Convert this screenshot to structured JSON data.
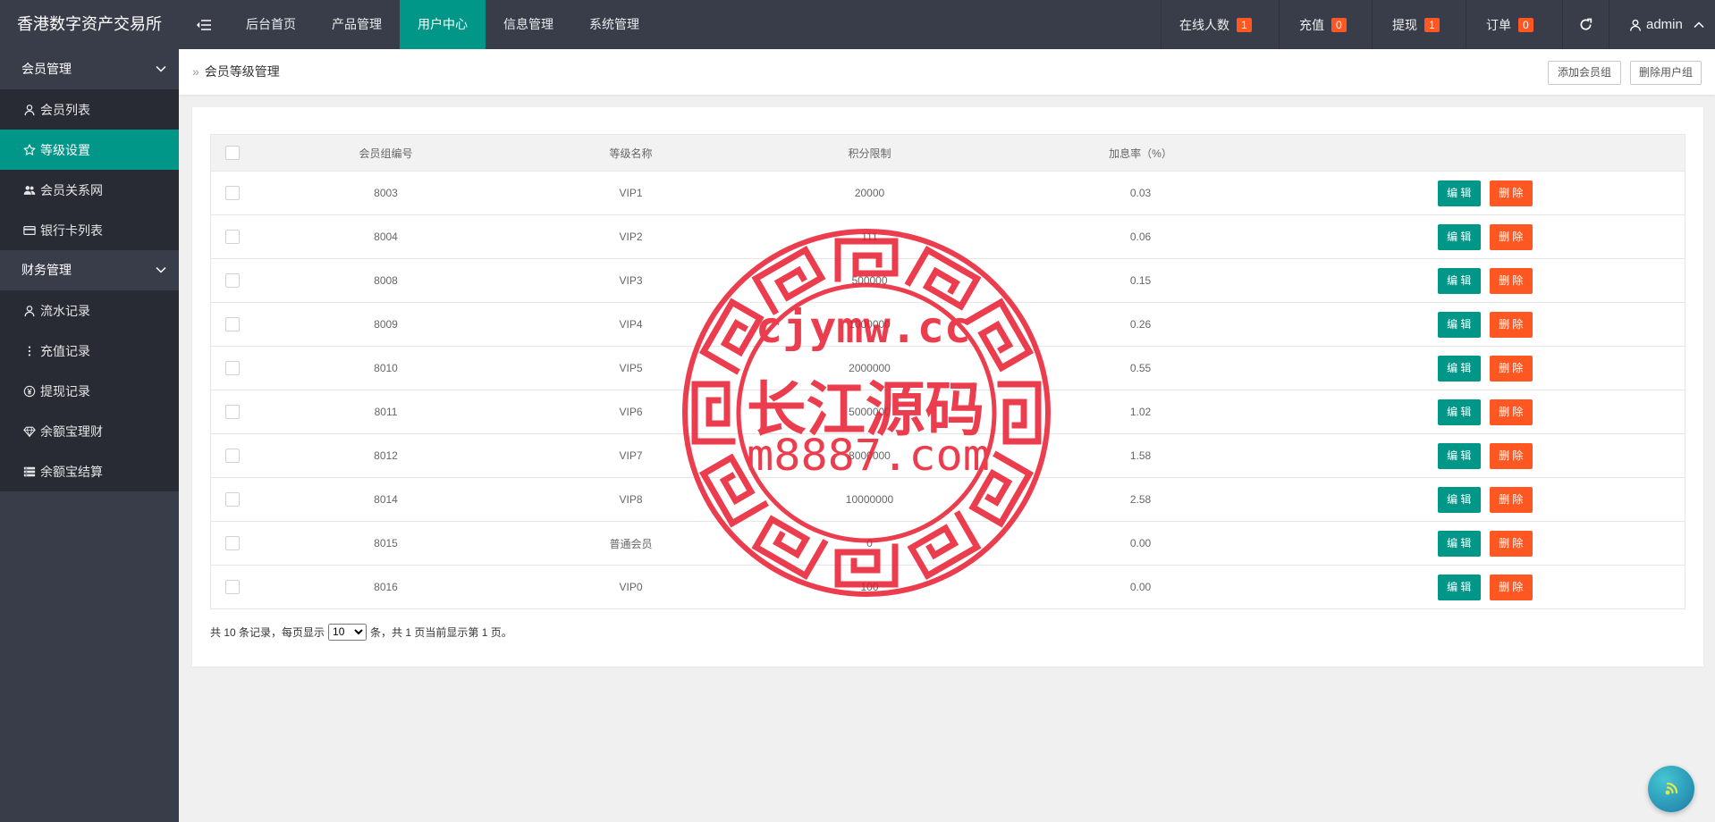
{
  "app": {
    "title": "香港数字资产交易所"
  },
  "colors": {
    "header_bg": "#393D49",
    "sidebar_sub_bg": "#282B33",
    "accent": "#009688",
    "danger": "#FF5722",
    "badge": "#FF5722",
    "watermark": "#E8192C"
  },
  "header": {
    "toggle_icon": "menu-shrink-icon",
    "nav": [
      {
        "label": "后台首页"
      },
      {
        "label": "产品管理"
      },
      {
        "label": "用户中心",
        "active": true
      },
      {
        "label": "信息管理"
      },
      {
        "label": "系统管理"
      }
    ],
    "stats": [
      {
        "label": "在线人数",
        "count": "1"
      },
      {
        "label": "充值",
        "count": "0"
      },
      {
        "label": "提现",
        "count": "1"
      },
      {
        "label": "订单",
        "count": "0"
      }
    ],
    "refresh_icon": "refresh-icon",
    "user": {
      "name": "admin",
      "icon": "user-icon",
      "caret_icon": "chevron-up-icon"
    }
  },
  "sidebar": {
    "groups": [
      {
        "label": "会员管理",
        "expanded": true,
        "items": [
          {
            "label": "会员列表",
            "icon": "user-icon"
          },
          {
            "label": "等级设置",
            "icon": "star-icon",
            "active": true
          },
          {
            "label": "会员关系网",
            "icon": "users-icon"
          },
          {
            "label": "银行卡列表",
            "icon": "credit-card-icon"
          }
        ]
      },
      {
        "label": "财务管理",
        "expanded": true,
        "items": [
          {
            "label": "流水记录",
            "icon": "user-icon"
          },
          {
            "label": "充值记录",
            "icon": "more-vertical-icon"
          },
          {
            "label": "提现记录",
            "icon": "yen-circle-icon"
          },
          {
            "label": "余额宝理财",
            "icon": "diamond-icon"
          },
          {
            "label": "余额宝结算",
            "icon": "server-icon"
          }
        ]
      }
    ]
  },
  "breadcrumb": {
    "separator": "»",
    "current": "会员等级管理"
  },
  "toolbar": {
    "add_label": "添加会员组",
    "delete_label": "删除用户组"
  },
  "table": {
    "columns": [
      "会员组编号",
      "等级名称",
      "积分限制",
      "加息率（%）"
    ],
    "rows": [
      {
        "id": "8003",
        "level": "VIP1",
        "points": "20000",
        "rate": "0.03"
      },
      {
        "id": "8004",
        "level": "VIP2",
        "points": "111",
        "rate": "0.06"
      },
      {
        "id": "8008",
        "level": "VIP3",
        "points": "500000",
        "rate": "0.15"
      },
      {
        "id": "8009",
        "level": "VIP4",
        "points": "1000000",
        "rate": "0.26"
      },
      {
        "id": "8010",
        "level": "VIP5",
        "points": "2000000",
        "rate": "0.55"
      },
      {
        "id": "8011",
        "level": "VIP6",
        "points": "5000000",
        "rate": "1.02"
      },
      {
        "id": "8012",
        "level": "VIP7",
        "points": "8000000",
        "rate": "1.58"
      },
      {
        "id": "8014",
        "level": "VIP8",
        "points": "10000000",
        "rate": "2.58"
      },
      {
        "id": "8015",
        "level": "普通会员",
        "points": "0",
        "rate": "0.00"
      },
      {
        "id": "8016",
        "level": "VIP0",
        "points": "100",
        "rate": "0.00"
      }
    ],
    "edit_label": "编 辑",
    "delete_label": "删 除"
  },
  "pagination": {
    "prefix": "共 10 条记录，每页显示",
    "page_size": "10",
    "suffix": "条，共 1 页当前显示第 1 页。"
  },
  "watermark": {
    "lines": [
      "cjymw.cc",
      "长江源码",
      "m8887.com"
    ]
  }
}
